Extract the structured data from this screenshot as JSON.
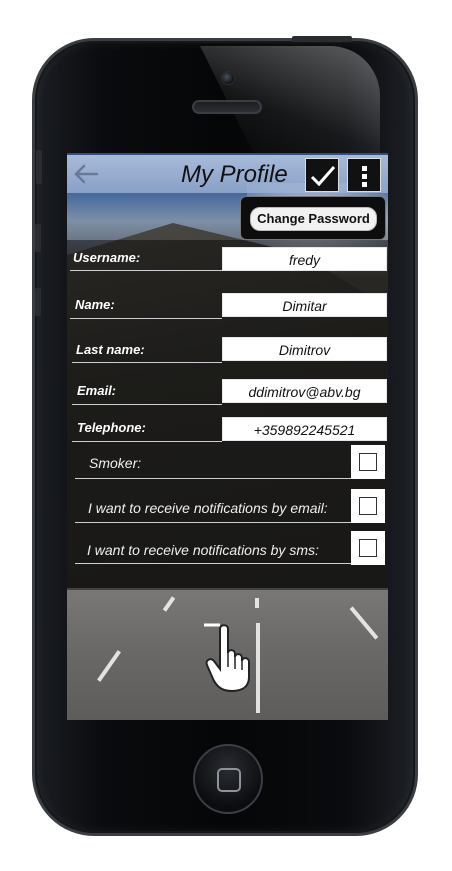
{
  "header": {
    "title": "My Profile"
  },
  "menu": {
    "change_password_label": "Change Password"
  },
  "form": {
    "fields": [
      {
        "label": "Username:",
        "value": "fredy"
      },
      {
        "label": "Name:",
        "value": "Dimitar"
      },
      {
        "label": "Last name:",
        "value": "Dimitrov"
      },
      {
        "label": "Email:",
        "value": "ddimitrov@abv.bg"
      },
      {
        "label": "Telephone:",
        "value": "+359892245521"
      }
    ],
    "checkboxes": [
      {
        "label": "Smoker:",
        "checked": false
      },
      {
        "label": "I want to receive notifications by email:",
        "checked": false
      },
      {
        "label": "I want to receive notifications by sms:",
        "checked": false
      }
    ]
  },
  "icons": {
    "back": "arrow-left-icon",
    "confirm": "checkmark-icon",
    "more": "vertical-dots-icon",
    "gesture": "hand-pointer-icon"
  }
}
